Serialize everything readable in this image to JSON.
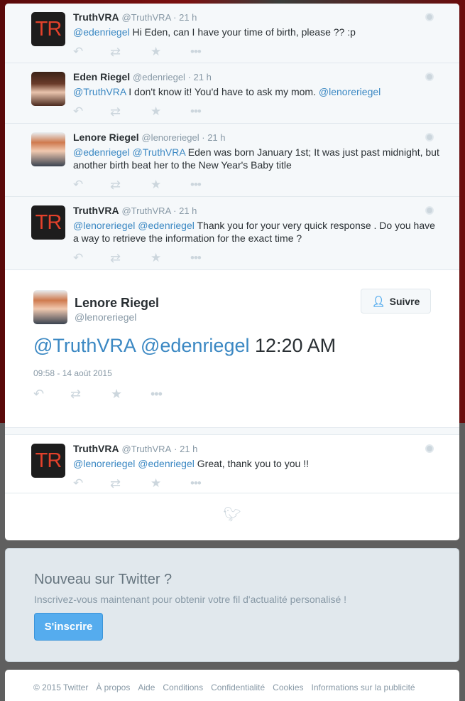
{
  "conversation": [
    {
      "name": "TruthVRA",
      "handle": "@TruthVRA",
      "time": "21 h",
      "avatar_text": "TR",
      "segments": [
        {
          "text": "@edenriegel",
          "mention": true
        },
        {
          "text": " Hi Eden, can I have your time of birth, please ?? :p",
          "mention": false
        }
      ]
    },
    {
      "name": "Eden Riegel",
      "handle": "@edenriegel",
      "time": "21 h",
      "segments": [
        {
          "text": "@TruthVRA",
          "mention": true
        },
        {
          "text": " I don't know it! You'd have to ask my mom. ",
          "mention": false
        },
        {
          "text": "@lenoreriegel",
          "mention": true
        }
      ]
    },
    {
      "name": "Lenore Riegel",
      "handle": "@lenoreriegel",
      "time": "21 h",
      "segments": [
        {
          "text": "@edenriegel",
          "mention": true
        },
        {
          "text": " ",
          "mention": false
        },
        {
          "text": "@TruthVRA",
          "mention": true
        },
        {
          "text": " Eden was born January 1st; It was just past midnight, but another birth beat her to the New Year's Baby title",
          "mention": false
        }
      ]
    },
    {
      "name": "TruthVRA",
      "handle": "@TruthVRA",
      "time": "21 h",
      "avatar_text": "TR",
      "segments": [
        {
          "text": "@lenoreriegel",
          "mention": true
        },
        {
          "text": " ",
          "mention": false
        },
        {
          "text": "@edenriegel",
          "mention": true
        },
        {
          "text": " Thank you for your very quick response . Do you have a way to retrieve the information for the exact time ?",
          "mention": false
        }
      ]
    }
  ],
  "main_tweet": {
    "name": "Lenore Riegel",
    "handle": "@lenoreriegel",
    "follow_label": "Suivre",
    "mention1": "@TruthVRA",
    "mention2": "@edenriegel",
    "text": "12:20 AM",
    "date": "09:58 - 14 août 2015"
  },
  "reply_tweet": {
    "name": "TruthVRA",
    "handle": "@TruthVRA",
    "time": "21 h",
    "avatar_text": "TR",
    "mention1": "@lenoreriegel",
    "mention2": "@edenriegel",
    "text": "Great, thank you to you !!"
  },
  "signup": {
    "title": "Nouveau sur Twitter ?",
    "subtitle": "Inscrivez-vous maintenant pour obtenir votre fil d'actualité personalisé !",
    "button": "S'inscrire"
  },
  "footer_links": [
    "© 2015 Twitter",
    "À propos",
    "Aide",
    "Conditions",
    "Confidentialité",
    "Cookies",
    "Informations sur la publicité"
  ],
  "icons": {
    "reply": "reply-icon",
    "retweet": "retweet-icon",
    "favorite": "star-icon",
    "more": "more-icon",
    "bird": "twitter-bird-icon",
    "globe": "globe-icon"
  },
  "colors": {
    "link": "#3b88c3",
    "button": "#55acee",
    "muted": "#8899a6"
  }
}
